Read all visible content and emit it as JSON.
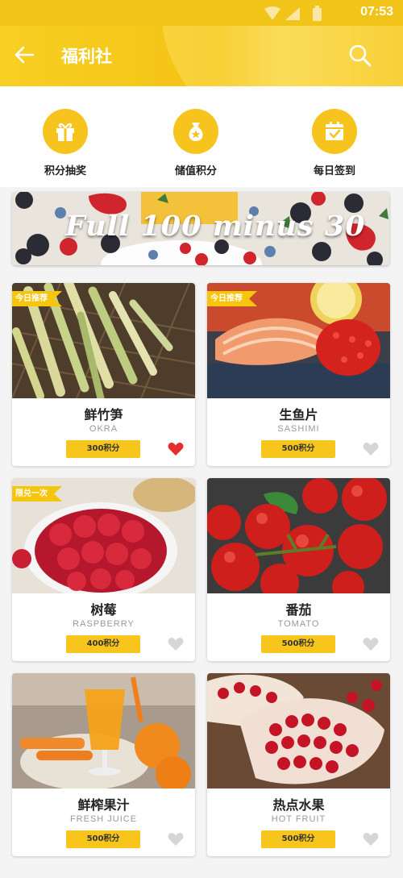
{
  "status_bar": {
    "time": "07:53"
  },
  "header": {
    "title": "福利社"
  },
  "features": [
    {
      "label": "积分抽奖",
      "icon": "gift-icon"
    },
    {
      "label": "储值积分",
      "icon": "money-bag-icon"
    },
    {
      "label": "每日签到",
      "icon": "calendar-check-icon"
    }
  ],
  "banner": {
    "text": "Full 100 minus 30"
  },
  "products": [
    {
      "name": "鲜竹笋",
      "en": "OKRA",
      "points": "300积分",
      "ribbon": "今日推荐",
      "favorited": true
    },
    {
      "name": "生鱼片",
      "en": "SASHIMI",
      "points": "500积分",
      "ribbon": "今日推荐",
      "favorited": false
    },
    {
      "name": "树莓",
      "en": "RASPBERRY",
      "points": "400积分",
      "ribbon": "限兑一次",
      "favorited": false
    },
    {
      "name": "番茄",
      "en": "TOMATO",
      "points": "500积分",
      "ribbon": "",
      "favorited": false
    },
    {
      "name": "鲜榨果汁",
      "en": "FRESH JUICE",
      "points": "500积分",
      "ribbon": "",
      "favorited": false
    },
    {
      "name": "热点水果",
      "en": "HOT FRUIT",
      "points": "500积分",
      "ribbon": "",
      "favorited": false
    }
  ],
  "colors": {
    "accent": "#f7c41d",
    "heart_active": "#e52d2d",
    "heart_inactive": "#d6d6d6"
  }
}
